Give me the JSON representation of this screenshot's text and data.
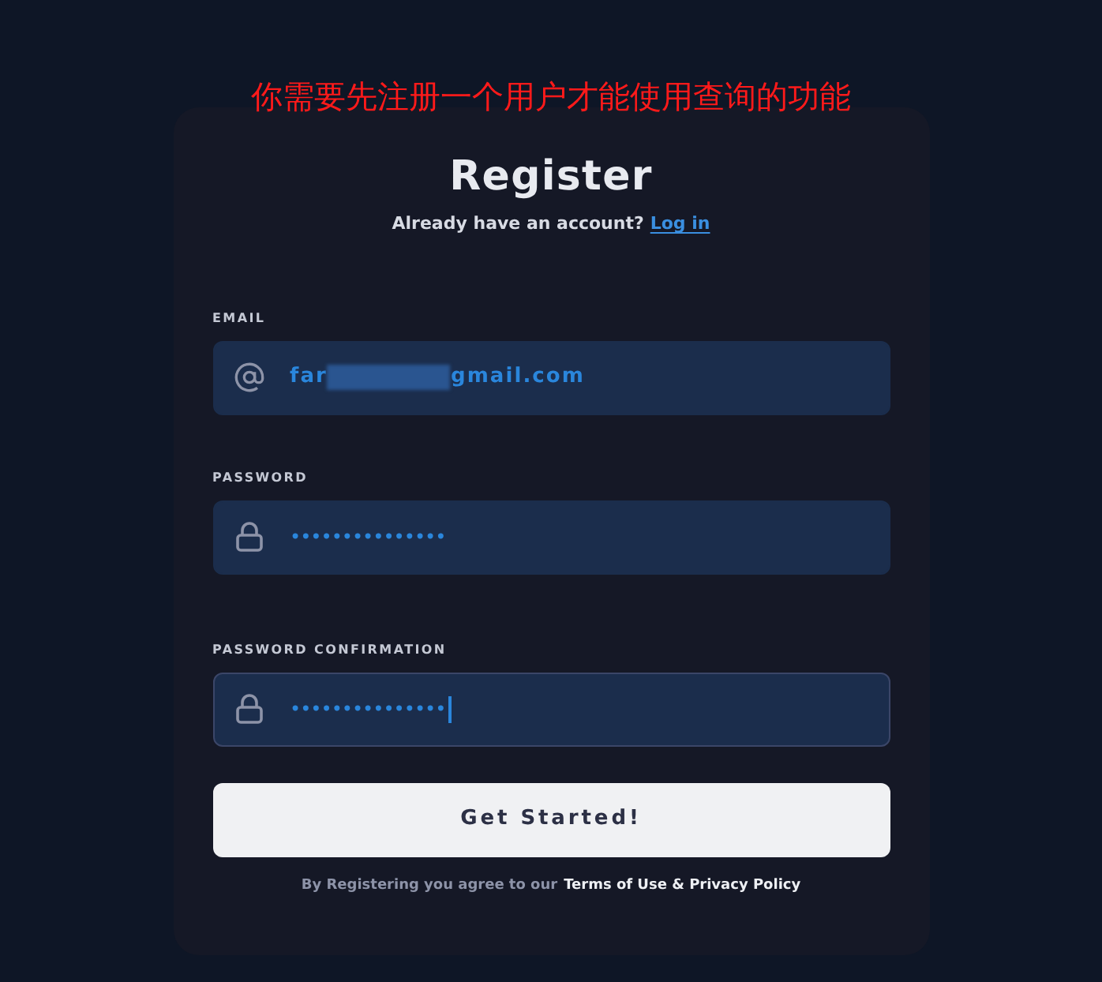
{
  "notice": "你需要先注册一个用户才能使用查询的功能",
  "title": "Register",
  "login_prompt": {
    "text": "Already have an account?",
    "link": "Log in"
  },
  "fields": [
    {
      "kind": "email",
      "label": "EMAIL",
      "value_start": "far",
      "value_end": "gmail.com",
      "redacted": true,
      "focused": false
    },
    {
      "kind": "password",
      "label": "PASSWORD",
      "value": "•••••••••••••••",
      "focused": false
    },
    {
      "kind": "password",
      "label": "PASSWORD CONFIRMATION",
      "value": "•••••••••••••••",
      "focused": true
    }
  ],
  "submit": "Get Started!",
  "terms": {
    "text": "By Registering you agree to our",
    "link": "Terms of Use & Privacy Policy"
  }
}
